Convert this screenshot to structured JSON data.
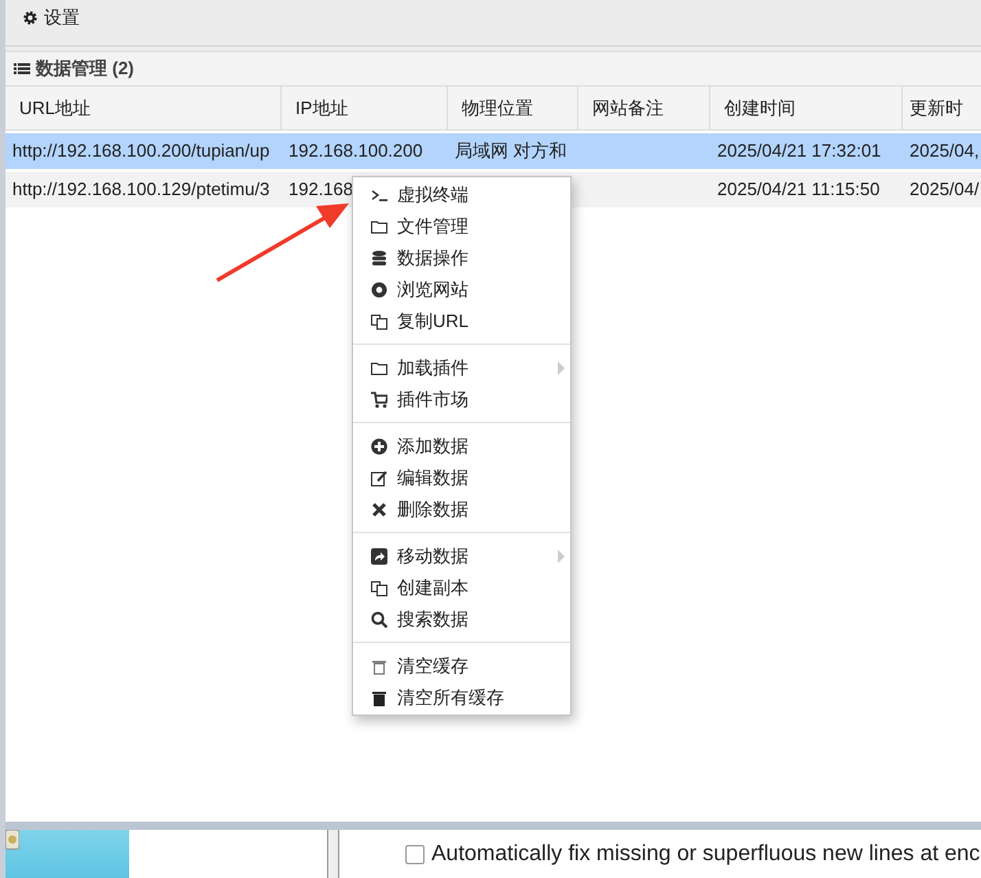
{
  "settings_bar": {
    "label": "设置"
  },
  "panel": {
    "title": "数据管理 (2)"
  },
  "table": {
    "columns": [
      "URL地址",
      "IP地址",
      "物理位置",
      "网站备注",
      "创建时间",
      "更新时"
    ],
    "rows": [
      {
        "selected": true,
        "cells": [
          "http://192.168.100.200/tupian/up",
          "192.168.100.200",
          "局域网 对方和",
          "",
          "2025/04/21 17:32:01",
          "2025/04,"
        ]
      },
      {
        "selected": false,
        "cells": [
          "http://192.168.100.129/ptetimu/3",
          "192.168",
          "",
          "",
          "2025/04/21 11:15:50",
          "2025/04/"
        ]
      }
    ]
  },
  "context_menu": {
    "groups": [
      [
        {
          "label": "虚拟终端",
          "submenu": false
        },
        {
          "label": "文件管理",
          "submenu": false
        },
        {
          "label": "数据操作",
          "submenu": false
        },
        {
          "label": "浏览网站",
          "submenu": false
        },
        {
          "label": "复制URL",
          "submenu": false
        }
      ],
      [
        {
          "label": "加载插件",
          "submenu": true
        },
        {
          "label": "插件市场",
          "submenu": false
        }
      ],
      [
        {
          "label": "添加数据",
          "submenu": false
        },
        {
          "label": "编辑数据",
          "submenu": false
        },
        {
          "label": "删除数据",
          "submenu": false
        }
      ],
      [
        {
          "label": "移动数据",
          "submenu": true
        },
        {
          "label": "创建副本",
          "submenu": false
        },
        {
          "label": "搜索数据",
          "submenu": false
        }
      ],
      [
        {
          "label": "清空缓存",
          "submenu": false
        },
        {
          "label": "清空所有缓存",
          "submenu": false
        }
      ]
    ]
  },
  "bottom": {
    "checkbox": {
      "label": "Automatically fix missing or superfluous new lines at enc",
      "checked": false
    }
  }
}
